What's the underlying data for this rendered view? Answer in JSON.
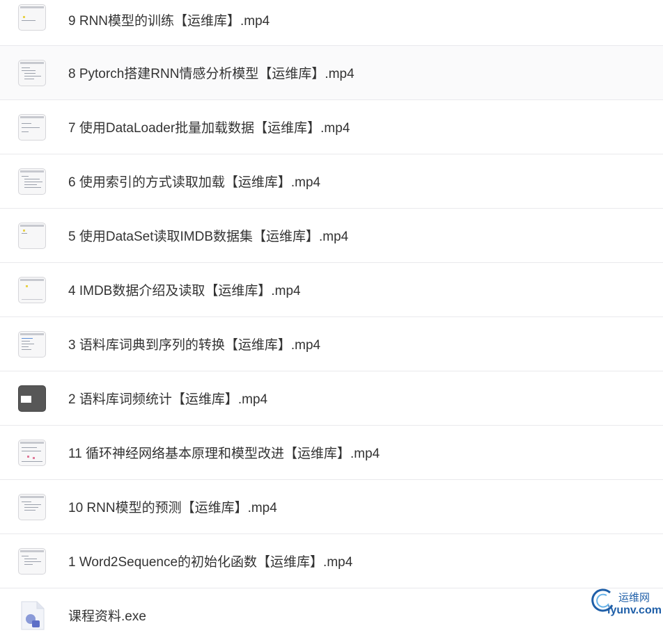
{
  "files": [
    {
      "name": "9 RNN模型的训练【运维库】.mp4",
      "thumbnail": "video-thumbnail-icon"
    },
    {
      "name": "8 Pytorch搭建RNN情感分析模型【运维库】.mp4",
      "thumbnail": "video-thumbnail-icon"
    },
    {
      "name": "7 使用DataLoader批量加载数据【运维库】.mp4",
      "thumbnail": "video-thumbnail-icon"
    },
    {
      "name": "6 使用索引的方式读取加载【运维库】.mp4",
      "thumbnail": "video-thumbnail-icon"
    },
    {
      "name": "5 使用DataSet读取IMDB数据集【运维库】.mp4",
      "thumbnail": "video-thumbnail-icon"
    },
    {
      "name": "4 IMDB数据介绍及读取【运维库】.mp4",
      "thumbnail": "video-thumbnail-icon"
    },
    {
      "name": "3 语料库词典到序列的转换【运维库】.mp4",
      "thumbnail": "video-thumbnail-icon"
    },
    {
      "name": "2 语料库词频统计【运维库】.mp4",
      "thumbnail": "video-thumbnail-dark-icon"
    },
    {
      "name": "11 循环神经网络基本原理和模型改进【运维库】.mp4",
      "thumbnail": "video-thumbnail-icon"
    },
    {
      "name": "10 RNN模型的预测【运维库】.mp4",
      "thumbnail": "video-thumbnail-icon"
    },
    {
      "name": "1 Word2Sequence的初始化函数【运维库】.mp4",
      "thumbnail": "video-thumbnail-icon"
    },
    {
      "name": "课程资料.exe",
      "thumbnail": "exe-file-icon"
    }
  ],
  "watermark": {
    "title": "运维网",
    "url": "iyunv.com"
  },
  "colors": {
    "text": "#333333",
    "divider": "#e9e9ec",
    "watermark": "#1f5fa8"
  }
}
